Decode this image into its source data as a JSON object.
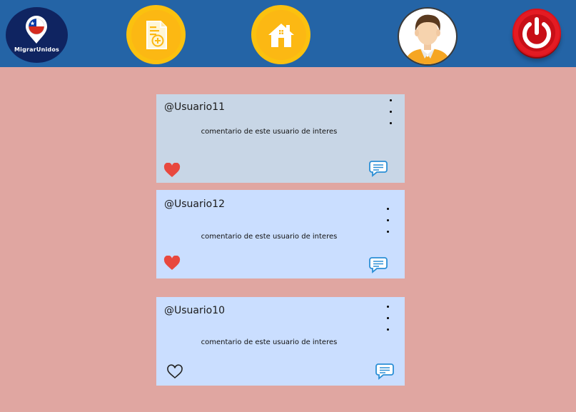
{
  "app": {
    "name": "MigrarUnidos"
  },
  "header": {
    "nav": [
      {
        "id": "new-post",
        "icon": "document-add-icon"
      },
      {
        "id": "home",
        "icon": "home-icon"
      },
      {
        "id": "profile",
        "icon": "user-avatar-icon"
      },
      {
        "id": "logout",
        "icon": "power-icon"
      }
    ],
    "colors": {
      "bar": "#2464a6",
      "button": "#fbc10f",
      "power": "#d8131b"
    }
  },
  "posts": [
    {
      "username": "@Usuario11",
      "comment": "comentario de este usuario de interes",
      "liked": true
    },
    {
      "username": "@Usuario12",
      "comment": "comentario de este usuario de interes",
      "liked": true
    },
    {
      "username": "@Usuario10",
      "comment": "comentario de este usuario de interes",
      "liked": false
    }
  ],
  "colors": {
    "background": "#e0a6a1",
    "card": "#cadeff",
    "heart": "#e8483e",
    "comment_icon": "#2b8fd6"
  }
}
